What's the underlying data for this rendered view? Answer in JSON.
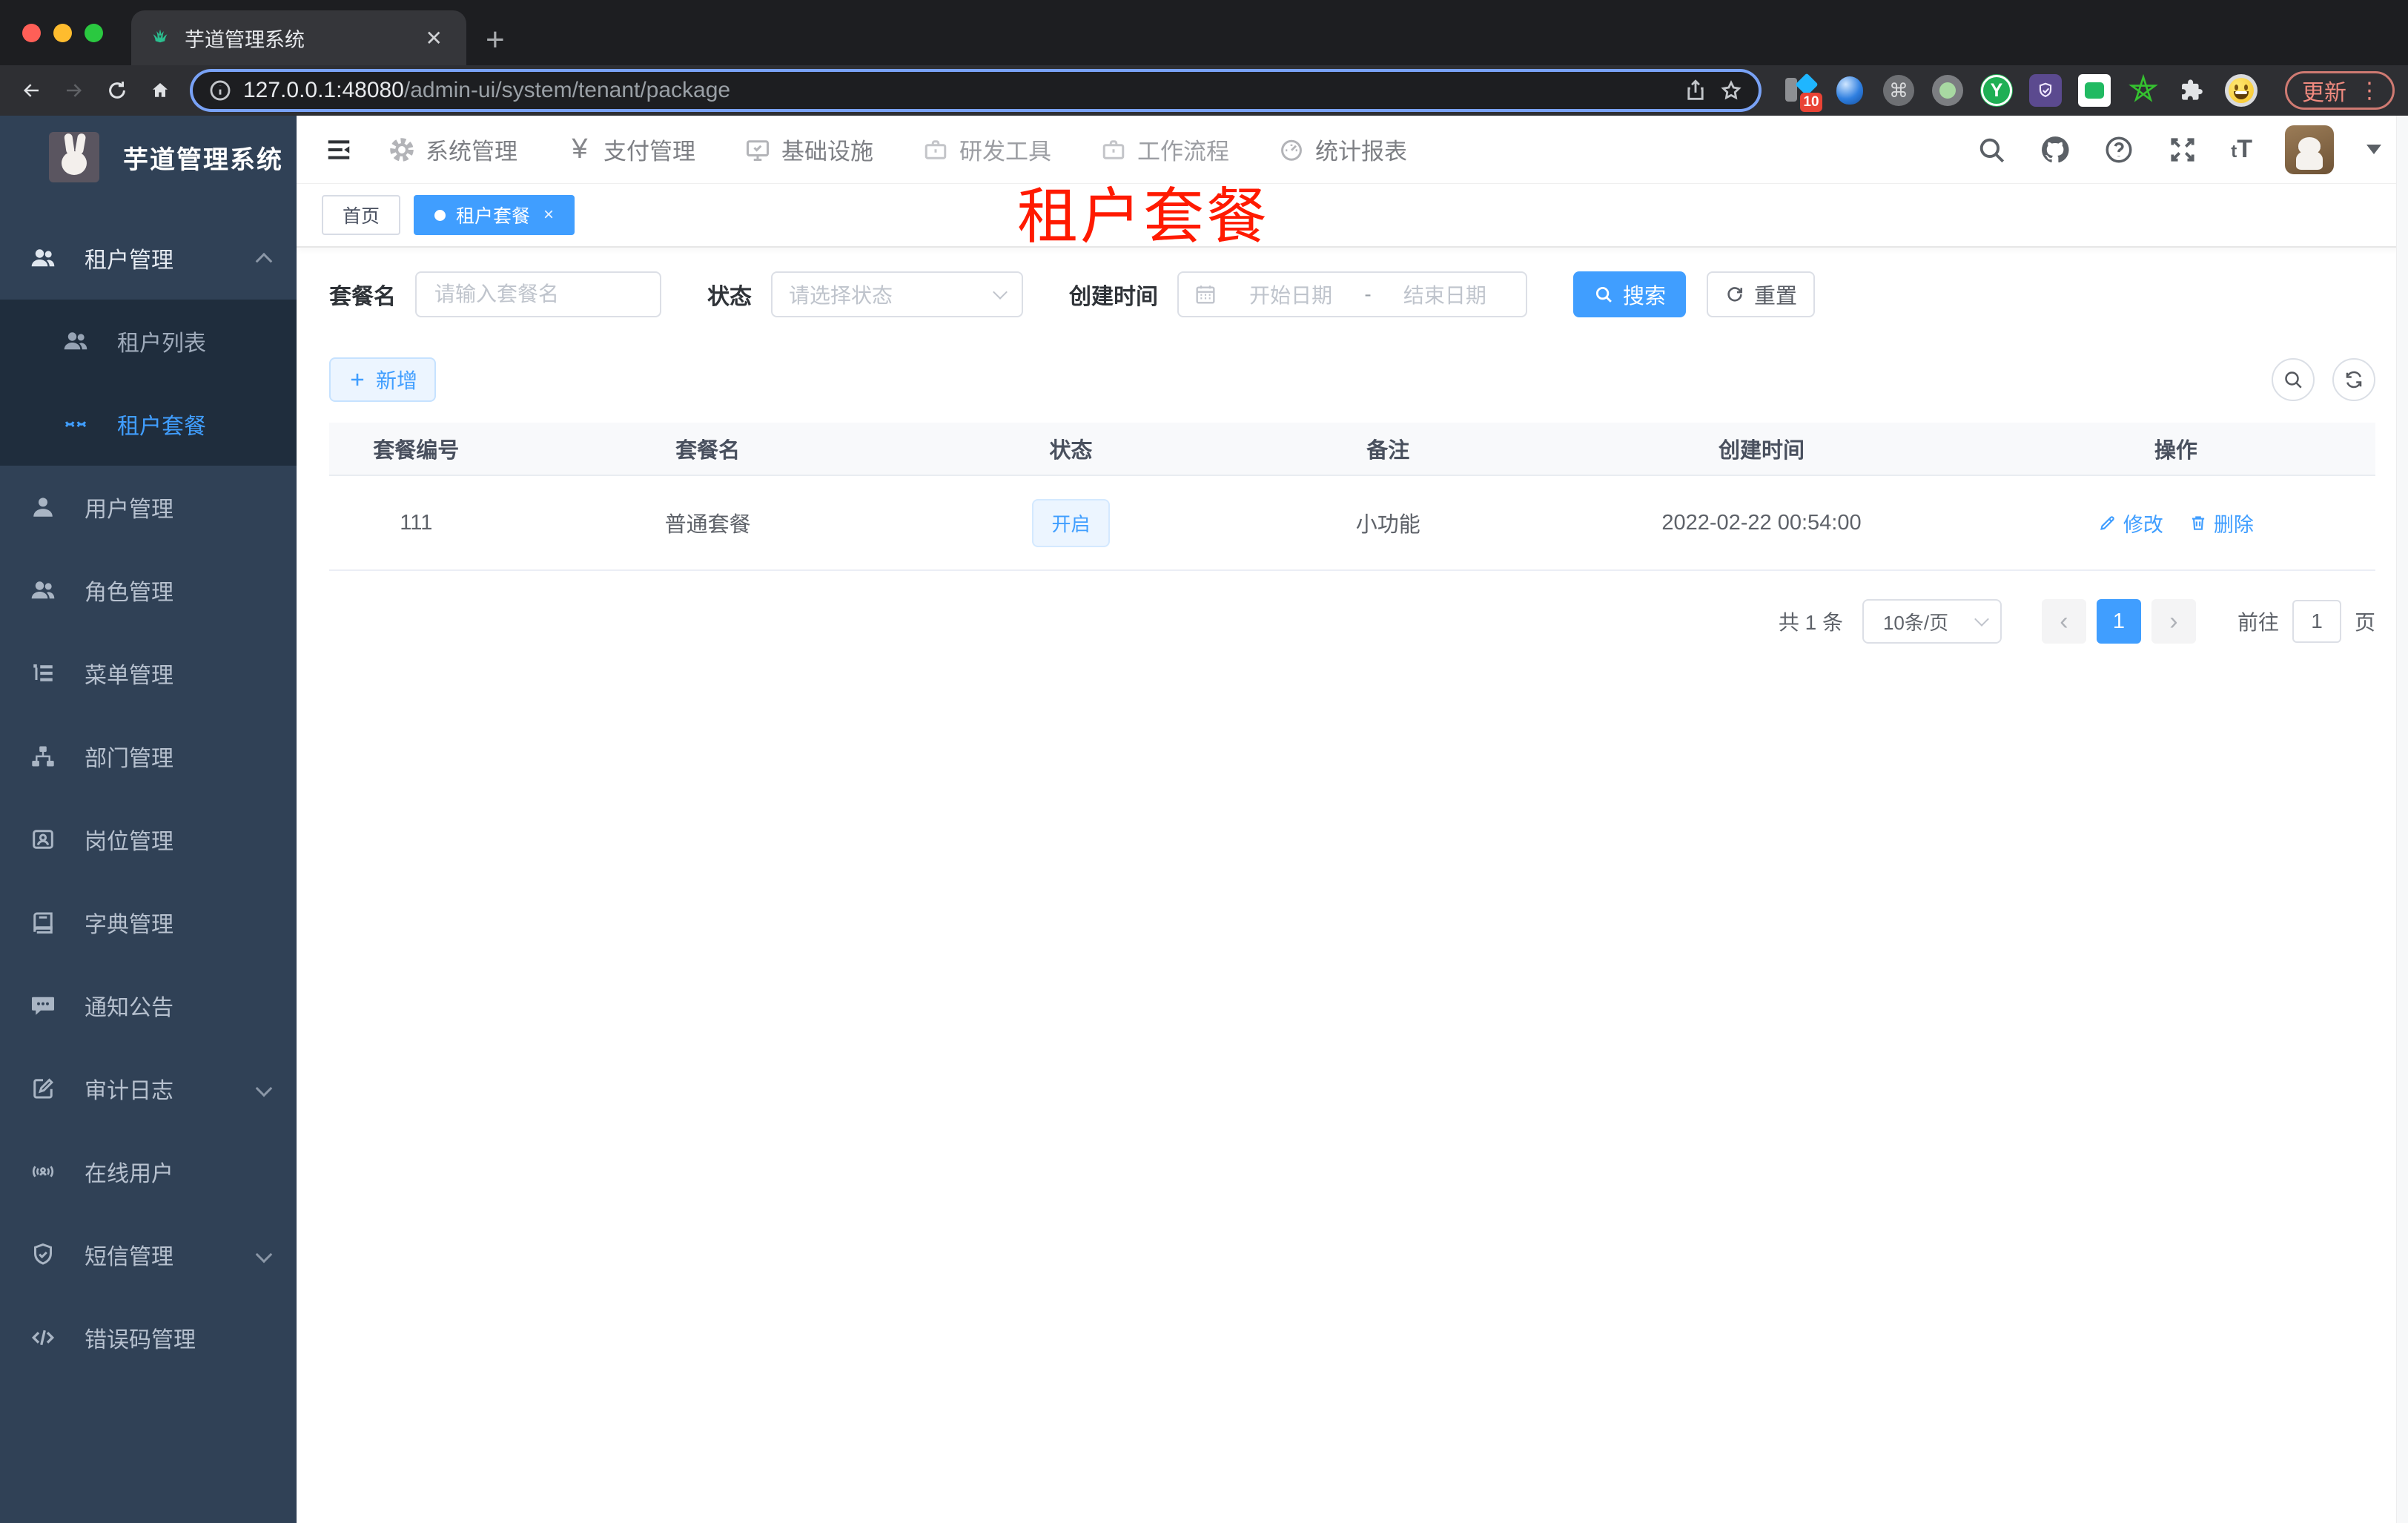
{
  "browser": {
    "tab_title": "芋道管理系统",
    "tab_close": "✕",
    "new_tab": "+",
    "url_host": "127.0.0.1:48080",
    "url_path": "/admin-ui/system/tenant/package",
    "ext_badge": "10",
    "cmd_glyph": "⌘",
    "ext_y_glyph": "Y",
    "update_label": "更新",
    "kebab_glyph": "⋮"
  },
  "app": {
    "logo_title": "芋道管理系统",
    "font_size_glyph_small": "t",
    "font_size_glyph_big": "T",
    "pay_glyph": "¥"
  },
  "topnav": {
    "items": [
      {
        "label": "系统管理"
      },
      {
        "label": "支付管理"
      },
      {
        "label": "基础设施"
      },
      {
        "label": "研发工具"
      },
      {
        "label": "工作流程"
      },
      {
        "label": "统计报表"
      }
    ]
  },
  "sidebar": {
    "items": [
      {
        "label": "租户管理"
      },
      {
        "label": "租户列表"
      },
      {
        "label": "租户套餐"
      },
      {
        "label": "用户管理"
      },
      {
        "label": "角色管理"
      },
      {
        "label": "菜单管理"
      },
      {
        "label": "部门管理"
      },
      {
        "label": "岗位管理"
      },
      {
        "label": "字典管理"
      },
      {
        "label": "通知公告"
      },
      {
        "label": "审计日志"
      },
      {
        "label": "在线用户"
      },
      {
        "label": "短信管理"
      },
      {
        "label": "错误码管理"
      }
    ]
  },
  "tags": {
    "home": "首页",
    "active": "租户套餐",
    "close": "×"
  },
  "overlay": {
    "title": "租户套餐"
  },
  "filters": {
    "name_label": "套餐名",
    "name_placeholder": "请输入套餐名",
    "status_label": "状态",
    "status_placeholder": "请选择状态",
    "date_label": "创建时间",
    "date_start": "开始日期",
    "date_separator": "-",
    "date_end": "结束日期",
    "search_label": "搜索",
    "reset_label": "重置"
  },
  "toolbar": {
    "add_label": "新增"
  },
  "table": {
    "headers": [
      "套餐编号",
      "套餐名",
      "状态",
      "备注",
      "创建时间",
      "操作"
    ],
    "rows": [
      {
        "code": "111",
        "name": "普通套餐",
        "status": "开启",
        "remark": "小功能",
        "created_at": "2022-02-22 00:54:00",
        "edit_label": "修改",
        "delete_label": "删除"
      }
    ]
  },
  "pagination": {
    "total": "共 1 条",
    "page_size": "10条/页",
    "prev": "‹",
    "current": "1",
    "next": "›",
    "goto_label": "前往",
    "goto_value": "1",
    "unit_label": "页"
  }
}
